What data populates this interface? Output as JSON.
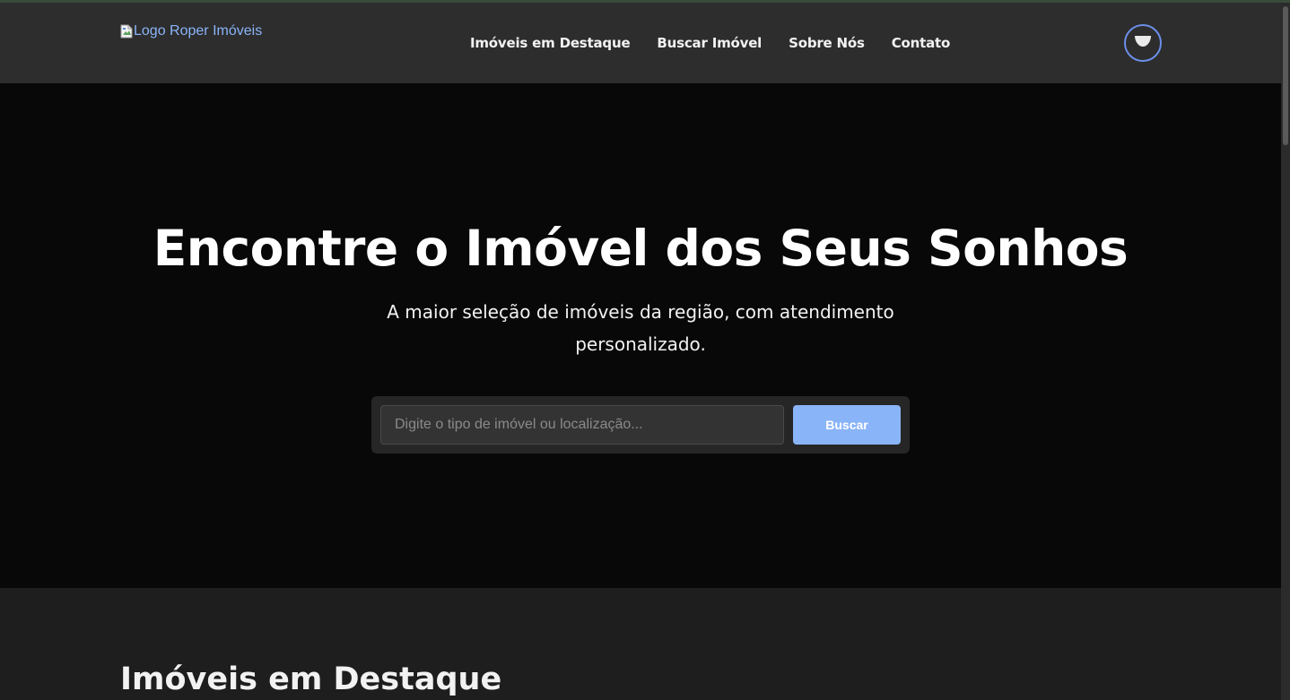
{
  "header": {
    "logo_alt": "Logo Roper Imóveis",
    "logo_icon": "broken-image-icon",
    "nav": [
      {
        "label": "Imóveis em Destaque"
      },
      {
        "label": "Buscar Imóvel"
      },
      {
        "label": "Sobre Nós"
      },
      {
        "label": "Contato"
      }
    ],
    "theme_toggle_icon": "moon-icon"
  },
  "hero": {
    "title": "Encontre o Imóvel dos Seus Sonhos",
    "subtitle": "A maior seleção de imóveis da região, com atendimento personalizado.",
    "search": {
      "placeholder": "Digite o tipo de imóvel ou localização...",
      "value": "",
      "button_label": "Buscar"
    }
  },
  "featured": {
    "title": "Imóveis em Destaque"
  },
  "colors": {
    "accent": "#8ab4f8",
    "header_bg": "#2d2d2d",
    "hero_bg": "#080808",
    "page_bg": "#1e1e1e"
  }
}
